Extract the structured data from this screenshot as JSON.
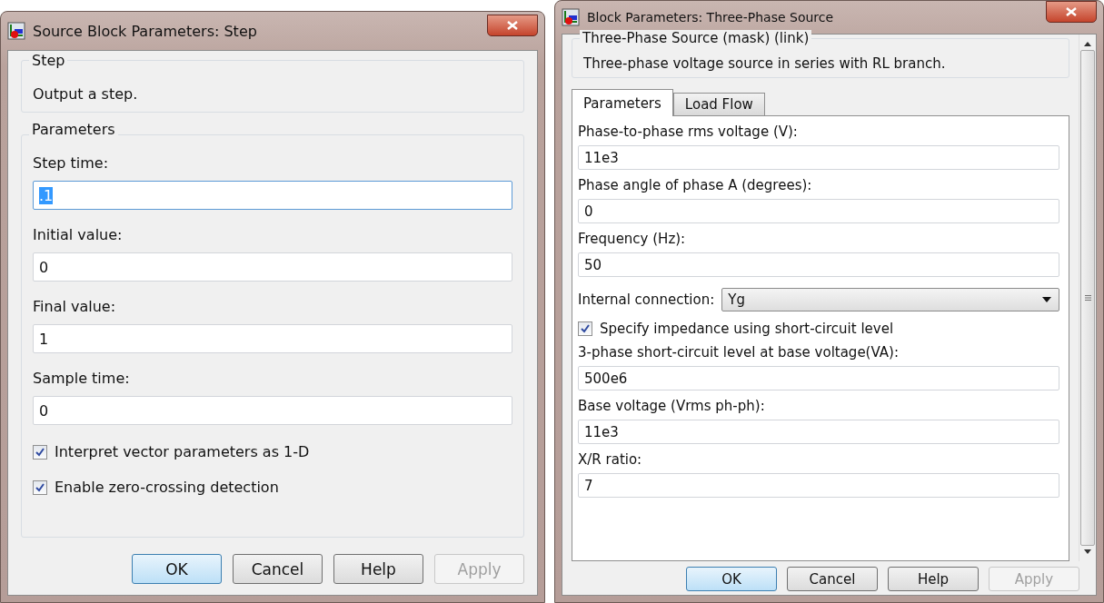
{
  "dialogs": [
    {
      "title": "Source Block Parameters: Step",
      "description": {
        "heading": "Step",
        "text": "Output a step."
      },
      "parameters_heading": "Parameters",
      "items": [
        {
          "kind": "field",
          "label": "Step time:",
          "value": ".1",
          "focused": true
        },
        {
          "kind": "field",
          "label": "Initial value:",
          "value": "0",
          "focused": false
        },
        {
          "kind": "field",
          "label": "Final value:",
          "value": "1",
          "focused": false
        },
        {
          "kind": "field",
          "label": "Sample time:",
          "value": "0",
          "focused": false
        },
        {
          "kind": "checkbox",
          "label": "Interpret vector parameters as 1-D",
          "checked": true
        },
        {
          "kind": "checkbox",
          "label": "Enable zero-crossing detection",
          "checked": true
        }
      ],
      "buttons": [
        {
          "label": "OK",
          "default": true,
          "disabled": false
        },
        {
          "label": "Cancel",
          "default": false,
          "disabled": false
        },
        {
          "label": "Help",
          "default": false,
          "disabled": false
        },
        {
          "label": "Apply",
          "default": false,
          "disabled": true
        }
      ]
    },
    {
      "title": "Block Parameters: Three-Phase Source",
      "description": {
        "heading": "Three-Phase Source (mask) (link)",
        "text": "Three-phase voltage source in series with RL branch."
      },
      "tabs": [
        {
          "label": "Parameters",
          "selected": true
        },
        {
          "label": "Load Flow",
          "selected": false
        }
      ],
      "items": [
        {
          "kind": "field",
          "label": "Phase-to-phase rms voltage (V):",
          "value": "11e3",
          "focused": false
        },
        {
          "kind": "field",
          "label": "Phase angle of phase A (degrees):",
          "value": "0",
          "focused": false
        },
        {
          "kind": "field",
          "label": "Frequency (Hz):",
          "value": "50",
          "focused": false
        },
        {
          "kind": "select",
          "label": "Internal connection:",
          "value": "Yg"
        },
        {
          "kind": "checkbox",
          "label": "Specify impedance using short-circuit level",
          "checked": true
        },
        {
          "kind": "field",
          "label": "3-phase short-circuit level at base voltage(VA):",
          "value": "500e6",
          "focused": false
        },
        {
          "kind": "field",
          "label": "Base voltage (Vrms ph-ph):",
          "value": "11e3",
          "focused": false
        },
        {
          "kind": "field",
          "label": "X/R ratio:",
          "value": "7",
          "focused": false
        }
      ],
      "buttons": [
        {
          "label": "OK",
          "default": true,
          "disabled": false
        },
        {
          "label": "Cancel",
          "default": false,
          "disabled": false
        },
        {
          "label": "Help",
          "default": false,
          "disabled": false
        },
        {
          "label": "Apply",
          "default": false,
          "disabled": true
        }
      ]
    }
  ]
}
